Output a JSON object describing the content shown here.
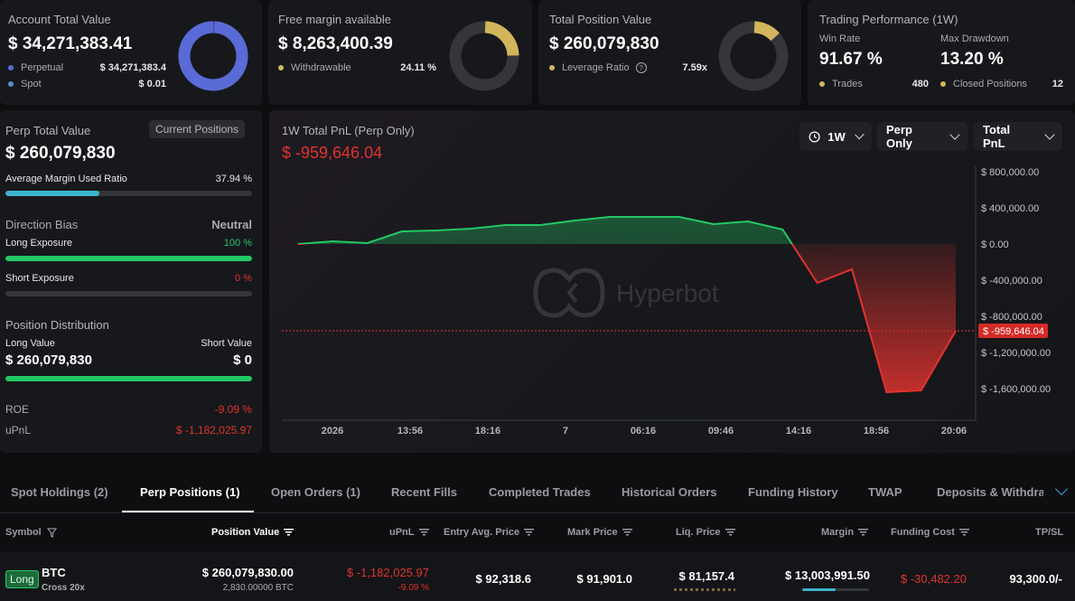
{
  "summary": {
    "account": {
      "label": "Account Total Value",
      "value": "$ 34,271,383.41",
      "items": [
        {
          "name": "Perpetual",
          "value": "$ 34,271,383.4",
          "color": "#5a6ad8"
        },
        {
          "name": "Spot",
          "value": "$ 0.01",
          "color": "#5a8ad8"
        }
      ],
      "donut_fraction": 0.995,
      "donut_color": "#5a6bd8"
    },
    "margin": {
      "label": "Free margin available",
      "value": "$ 8,263,400.39",
      "item_name": "Withdrawable",
      "item_value": "24.11 %",
      "donut_fraction": 0.2411,
      "donut_color": "#d2b55b"
    },
    "position": {
      "label": "Total Position Value",
      "value": "$ 260,079,830",
      "item_name": "Leverage Ratio",
      "item_value": "7.59x",
      "donut_fraction": 0.13,
      "donut_color": "#d2b55b"
    },
    "performance": {
      "label": "Trading Performance (1W)",
      "win_label": "Win Rate",
      "win_value": "91.67 %",
      "dd_label": "Max Drawdown",
      "dd_value": "13.20 %",
      "trades_label": "Trades",
      "trades_value": "480",
      "closed_label": "Closed Positions",
      "closed_value": "12"
    }
  },
  "left": {
    "perp_label": "Perp Total Value",
    "current_positions_btn": "Current Positions",
    "perp_value": "$ 260,079,830",
    "amur_label": "Average Margin Used Ratio",
    "amur_value": "37.94 %",
    "amur_fraction": 0.3794,
    "bias_label": "Direction Bias",
    "bias_value": "Neutral",
    "long_exp_label": "Long Exposure",
    "long_exp_value": "100 %",
    "long_exp_fraction": 1.0,
    "short_exp_label": "Short Exposure",
    "short_exp_value": "0 %",
    "short_exp_fraction": 0.0,
    "dist_label": "Position Distribution",
    "long_value_label": "Long Value",
    "short_value_label": "Short Value",
    "long_value": "$ 260,079,830",
    "short_value": "$ 0",
    "long_share": 1.0,
    "roe_label": "ROE",
    "roe_value": "-9.09 %",
    "upnl_label": "uPnL",
    "upnl_value": "$ -1,182,025.97"
  },
  "chart": {
    "title": "1W Total PnL (Perp Only)",
    "current_value": "$ -959,646.04",
    "current_tag": "$ -959,646.04",
    "watermark": "Hyperbot",
    "dropdowns": [
      "1W",
      "Perp Only",
      "Total PnL"
    ]
  },
  "chart_data": {
    "type": "area",
    "title": "1W Total PnL (Perp Only)",
    "x_tick_labels": [
      "2026",
      "13:56",
      "18:16",
      "7",
      "06:16",
      "09:46",
      "14:16",
      "18:56",
      "20:06"
    ],
    "y_tick_labels": [
      "$ 800,000.00",
      "$ 400,000.00",
      "$ 0.00",
      "$ -400,000.00",
      "$ -800,000.00",
      "$ -1,200,000.00",
      "$ -1,600,000.00"
    ],
    "ylim": [
      -1800000,
      900000
    ],
    "y_ticks": [
      800000,
      400000,
      0,
      -400000,
      -800000,
      -1200000,
      -1600000
    ],
    "current_value": -959646.04,
    "series": [
      {
        "values": [
          0,
          30000,
          10000,
          140000,
          150000,
          170000,
          210000,
          210000,
          260000,
          300000,
          300000,
          300000,
          220000,
          250000,
          160000,
          -430000,
          -280000,
          -1640000,
          -1620000,
          -959646.04
        ]
      }
    ],
    "grid": false,
    "legend": "none"
  },
  "tabs": [
    {
      "label": "Spot Holdings (2)",
      "active": false
    },
    {
      "label": "Perp Positions (1)",
      "active": true
    },
    {
      "label": "Open Orders (1)",
      "active": false
    },
    {
      "label": "Recent Fills",
      "active": false
    },
    {
      "label": "Completed Trades",
      "active": false
    },
    {
      "label": "Historical Orders",
      "active": false
    },
    {
      "label": "Funding History",
      "active": false
    },
    {
      "label": "TWAP",
      "active": false
    },
    {
      "label": "Deposits & Withdraw",
      "active": false
    }
  ],
  "table": {
    "headers": {
      "symbol": "Symbol",
      "position_value": "Position Value",
      "upnl": "uPnL",
      "entry": "Entry Avg. Price",
      "mark": "Mark Price",
      "liq": "Liq. Price",
      "margin": "Margin",
      "funding": "Funding Cost",
      "tpsl": "TP/SL"
    },
    "rows": [
      {
        "side": "Long",
        "symbol": "BTC",
        "mode": "Cross 20x",
        "position_value": "$ 260,079,830.00",
        "position_size": "2,830.00000 BTC",
        "upnl": "$ -1,182,025.97",
        "upnl_pct": "-9.09 %",
        "entry": "$ 92,318.6",
        "mark": "$ 91,901.0",
        "liq": "$ 81,157.4",
        "margin": "$ 13,003,991.50",
        "margin_fraction": 0.5,
        "funding": "$ -30,482.20",
        "tpsl": "93,300.0/-"
      }
    ]
  }
}
